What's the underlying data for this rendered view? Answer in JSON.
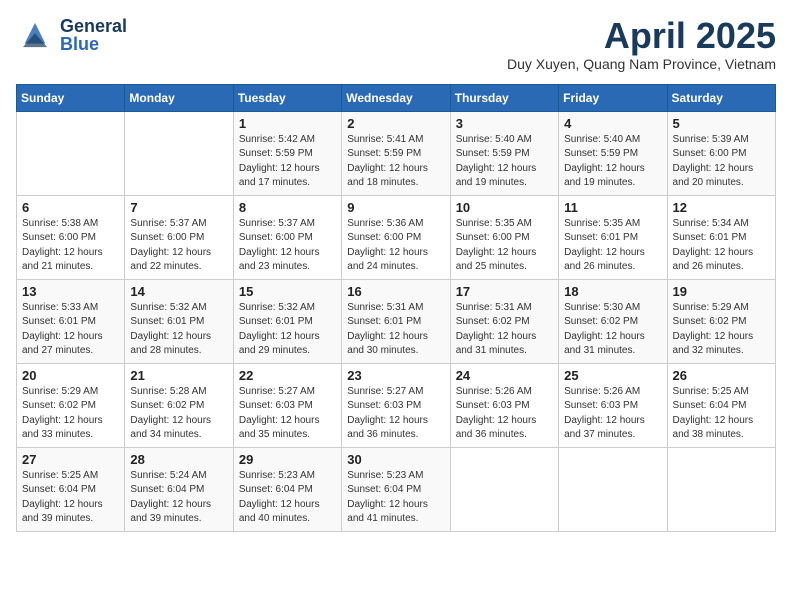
{
  "header": {
    "logo_general": "General",
    "logo_blue": "Blue",
    "month_year": "April 2025",
    "location": "Duy Xuyen, Quang Nam Province, Vietnam"
  },
  "calendar": {
    "days_of_week": [
      "Sunday",
      "Monday",
      "Tuesday",
      "Wednesday",
      "Thursday",
      "Friday",
      "Saturday"
    ],
    "weeks": [
      [
        {
          "day": "",
          "info": ""
        },
        {
          "day": "",
          "info": ""
        },
        {
          "day": "1",
          "info": "Sunrise: 5:42 AM\nSunset: 5:59 PM\nDaylight: 12 hours and 17 minutes."
        },
        {
          "day": "2",
          "info": "Sunrise: 5:41 AM\nSunset: 5:59 PM\nDaylight: 12 hours and 18 minutes."
        },
        {
          "day": "3",
          "info": "Sunrise: 5:40 AM\nSunset: 5:59 PM\nDaylight: 12 hours and 19 minutes."
        },
        {
          "day": "4",
          "info": "Sunrise: 5:40 AM\nSunset: 5:59 PM\nDaylight: 12 hours and 19 minutes."
        },
        {
          "day": "5",
          "info": "Sunrise: 5:39 AM\nSunset: 6:00 PM\nDaylight: 12 hours and 20 minutes."
        }
      ],
      [
        {
          "day": "6",
          "info": "Sunrise: 5:38 AM\nSunset: 6:00 PM\nDaylight: 12 hours and 21 minutes."
        },
        {
          "day": "7",
          "info": "Sunrise: 5:37 AM\nSunset: 6:00 PM\nDaylight: 12 hours and 22 minutes."
        },
        {
          "day": "8",
          "info": "Sunrise: 5:37 AM\nSunset: 6:00 PM\nDaylight: 12 hours and 23 minutes."
        },
        {
          "day": "9",
          "info": "Sunrise: 5:36 AM\nSunset: 6:00 PM\nDaylight: 12 hours and 24 minutes."
        },
        {
          "day": "10",
          "info": "Sunrise: 5:35 AM\nSunset: 6:00 PM\nDaylight: 12 hours and 25 minutes."
        },
        {
          "day": "11",
          "info": "Sunrise: 5:35 AM\nSunset: 6:01 PM\nDaylight: 12 hours and 26 minutes."
        },
        {
          "day": "12",
          "info": "Sunrise: 5:34 AM\nSunset: 6:01 PM\nDaylight: 12 hours and 26 minutes."
        }
      ],
      [
        {
          "day": "13",
          "info": "Sunrise: 5:33 AM\nSunset: 6:01 PM\nDaylight: 12 hours and 27 minutes."
        },
        {
          "day": "14",
          "info": "Sunrise: 5:32 AM\nSunset: 6:01 PM\nDaylight: 12 hours and 28 minutes."
        },
        {
          "day": "15",
          "info": "Sunrise: 5:32 AM\nSunset: 6:01 PM\nDaylight: 12 hours and 29 minutes."
        },
        {
          "day": "16",
          "info": "Sunrise: 5:31 AM\nSunset: 6:01 PM\nDaylight: 12 hours and 30 minutes."
        },
        {
          "day": "17",
          "info": "Sunrise: 5:31 AM\nSunset: 6:02 PM\nDaylight: 12 hours and 31 minutes."
        },
        {
          "day": "18",
          "info": "Sunrise: 5:30 AM\nSunset: 6:02 PM\nDaylight: 12 hours and 31 minutes."
        },
        {
          "day": "19",
          "info": "Sunrise: 5:29 AM\nSunset: 6:02 PM\nDaylight: 12 hours and 32 minutes."
        }
      ],
      [
        {
          "day": "20",
          "info": "Sunrise: 5:29 AM\nSunset: 6:02 PM\nDaylight: 12 hours and 33 minutes."
        },
        {
          "day": "21",
          "info": "Sunrise: 5:28 AM\nSunset: 6:02 PM\nDaylight: 12 hours and 34 minutes."
        },
        {
          "day": "22",
          "info": "Sunrise: 5:27 AM\nSunset: 6:03 PM\nDaylight: 12 hours and 35 minutes."
        },
        {
          "day": "23",
          "info": "Sunrise: 5:27 AM\nSunset: 6:03 PM\nDaylight: 12 hours and 36 minutes."
        },
        {
          "day": "24",
          "info": "Sunrise: 5:26 AM\nSunset: 6:03 PM\nDaylight: 12 hours and 36 minutes."
        },
        {
          "day": "25",
          "info": "Sunrise: 5:26 AM\nSunset: 6:03 PM\nDaylight: 12 hours and 37 minutes."
        },
        {
          "day": "26",
          "info": "Sunrise: 5:25 AM\nSunset: 6:04 PM\nDaylight: 12 hours and 38 minutes."
        }
      ],
      [
        {
          "day": "27",
          "info": "Sunrise: 5:25 AM\nSunset: 6:04 PM\nDaylight: 12 hours and 39 minutes."
        },
        {
          "day": "28",
          "info": "Sunrise: 5:24 AM\nSunset: 6:04 PM\nDaylight: 12 hours and 39 minutes."
        },
        {
          "day": "29",
          "info": "Sunrise: 5:23 AM\nSunset: 6:04 PM\nDaylight: 12 hours and 40 minutes."
        },
        {
          "day": "30",
          "info": "Sunrise: 5:23 AM\nSunset: 6:04 PM\nDaylight: 12 hours and 41 minutes."
        },
        {
          "day": "",
          "info": ""
        },
        {
          "day": "",
          "info": ""
        },
        {
          "day": "",
          "info": ""
        }
      ]
    ]
  }
}
